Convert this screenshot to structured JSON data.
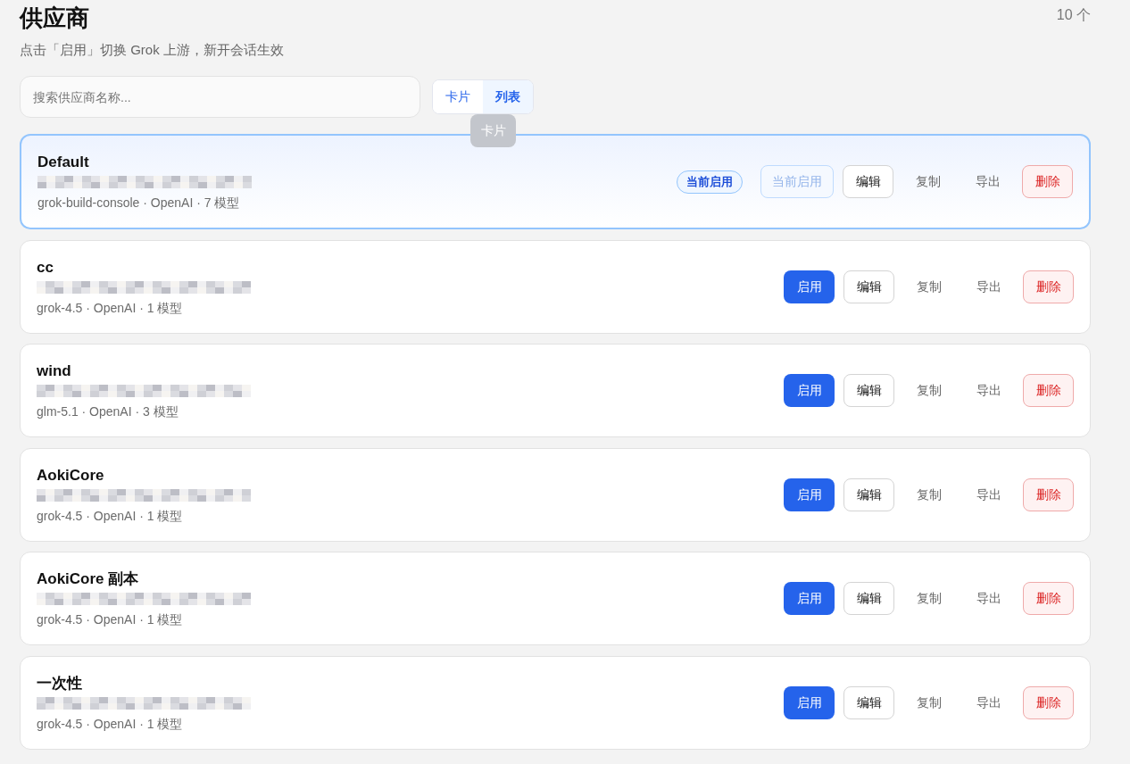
{
  "header": {
    "title": "供应商",
    "subtitle": "点击「启用」切换 Grok 上游，新开会话生效",
    "count": "10 个"
  },
  "search": {
    "placeholder": "搜索供应商名称..."
  },
  "view_toggle": [
    {
      "label": "卡片",
      "selected": false
    },
    {
      "label": "列表",
      "selected": true
    }
  ],
  "tooltip": {
    "text": "卡片"
  },
  "providers": [
    {
      "name": "Default",
      "meta": "grok-build-console · OpenAI · 7 模型",
      "active": true,
      "badge": "当前启用",
      "actions": [
        {
          "kind": "primary",
          "label": "当前启用",
          "disabled": true
        },
        {
          "kind": "outline",
          "label": "编辑",
          "disabled": false
        },
        {
          "kind": "ghost",
          "label": "复制",
          "disabled": false
        },
        {
          "kind": "ghost",
          "label": "导出",
          "disabled": false
        },
        {
          "kind": "danger",
          "label": "删除",
          "disabled": false
        }
      ]
    },
    {
      "name": "cc",
      "meta": "grok-4.5 · OpenAI · 1 模型",
      "active": false,
      "actions": [
        {
          "kind": "primary",
          "label": "启用",
          "disabled": false
        },
        {
          "kind": "outline",
          "label": "编辑",
          "disabled": false
        },
        {
          "kind": "ghost",
          "label": "复制",
          "disabled": false
        },
        {
          "kind": "ghost",
          "label": "导出",
          "disabled": false
        },
        {
          "kind": "danger",
          "label": "删除",
          "disabled": false
        }
      ]
    },
    {
      "name": "wind",
      "meta": "glm-5.1 · OpenAI · 3 模型",
      "active": false,
      "actions": [
        {
          "kind": "primary",
          "label": "启用",
          "disabled": false
        },
        {
          "kind": "outline",
          "label": "编辑",
          "disabled": false
        },
        {
          "kind": "ghost",
          "label": "复制",
          "disabled": false
        },
        {
          "kind": "ghost",
          "label": "导出",
          "disabled": false
        },
        {
          "kind": "danger",
          "label": "删除",
          "disabled": false
        }
      ]
    },
    {
      "name": "AokiCore",
      "meta": "grok-4.5 · OpenAI · 1 模型",
      "active": false,
      "actions": [
        {
          "kind": "primary",
          "label": "启用",
          "disabled": false
        },
        {
          "kind": "outline",
          "label": "编辑",
          "disabled": false
        },
        {
          "kind": "ghost",
          "label": "复制",
          "disabled": false
        },
        {
          "kind": "ghost",
          "label": "导出",
          "disabled": false
        },
        {
          "kind": "danger",
          "label": "删除",
          "disabled": false
        }
      ]
    },
    {
      "name": "AokiCore 副本",
      "meta": "grok-4.5 · OpenAI · 1 模型",
      "active": false,
      "actions": [
        {
          "kind": "primary",
          "label": "启用",
          "disabled": false
        },
        {
          "kind": "outline",
          "label": "编辑",
          "disabled": false
        },
        {
          "kind": "ghost",
          "label": "复制",
          "disabled": false
        },
        {
          "kind": "ghost",
          "label": "导出",
          "disabled": false
        },
        {
          "kind": "danger",
          "label": "删除",
          "disabled": false
        }
      ]
    },
    {
      "name": "一次性",
      "meta": "grok-4.5 · OpenAI · 1 模型",
      "active": false,
      "actions": [
        {
          "kind": "primary",
          "label": "启用",
          "disabled": false
        },
        {
          "kind": "outline",
          "label": "编辑",
          "disabled": false
        },
        {
          "kind": "ghost",
          "label": "复制",
          "disabled": false
        },
        {
          "kind": "ghost",
          "label": "导出",
          "disabled": false
        },
        {
          "kind": "danger",
          "label": "删除",
          "disabled": false
        }
      ]
    }
  ]
}
